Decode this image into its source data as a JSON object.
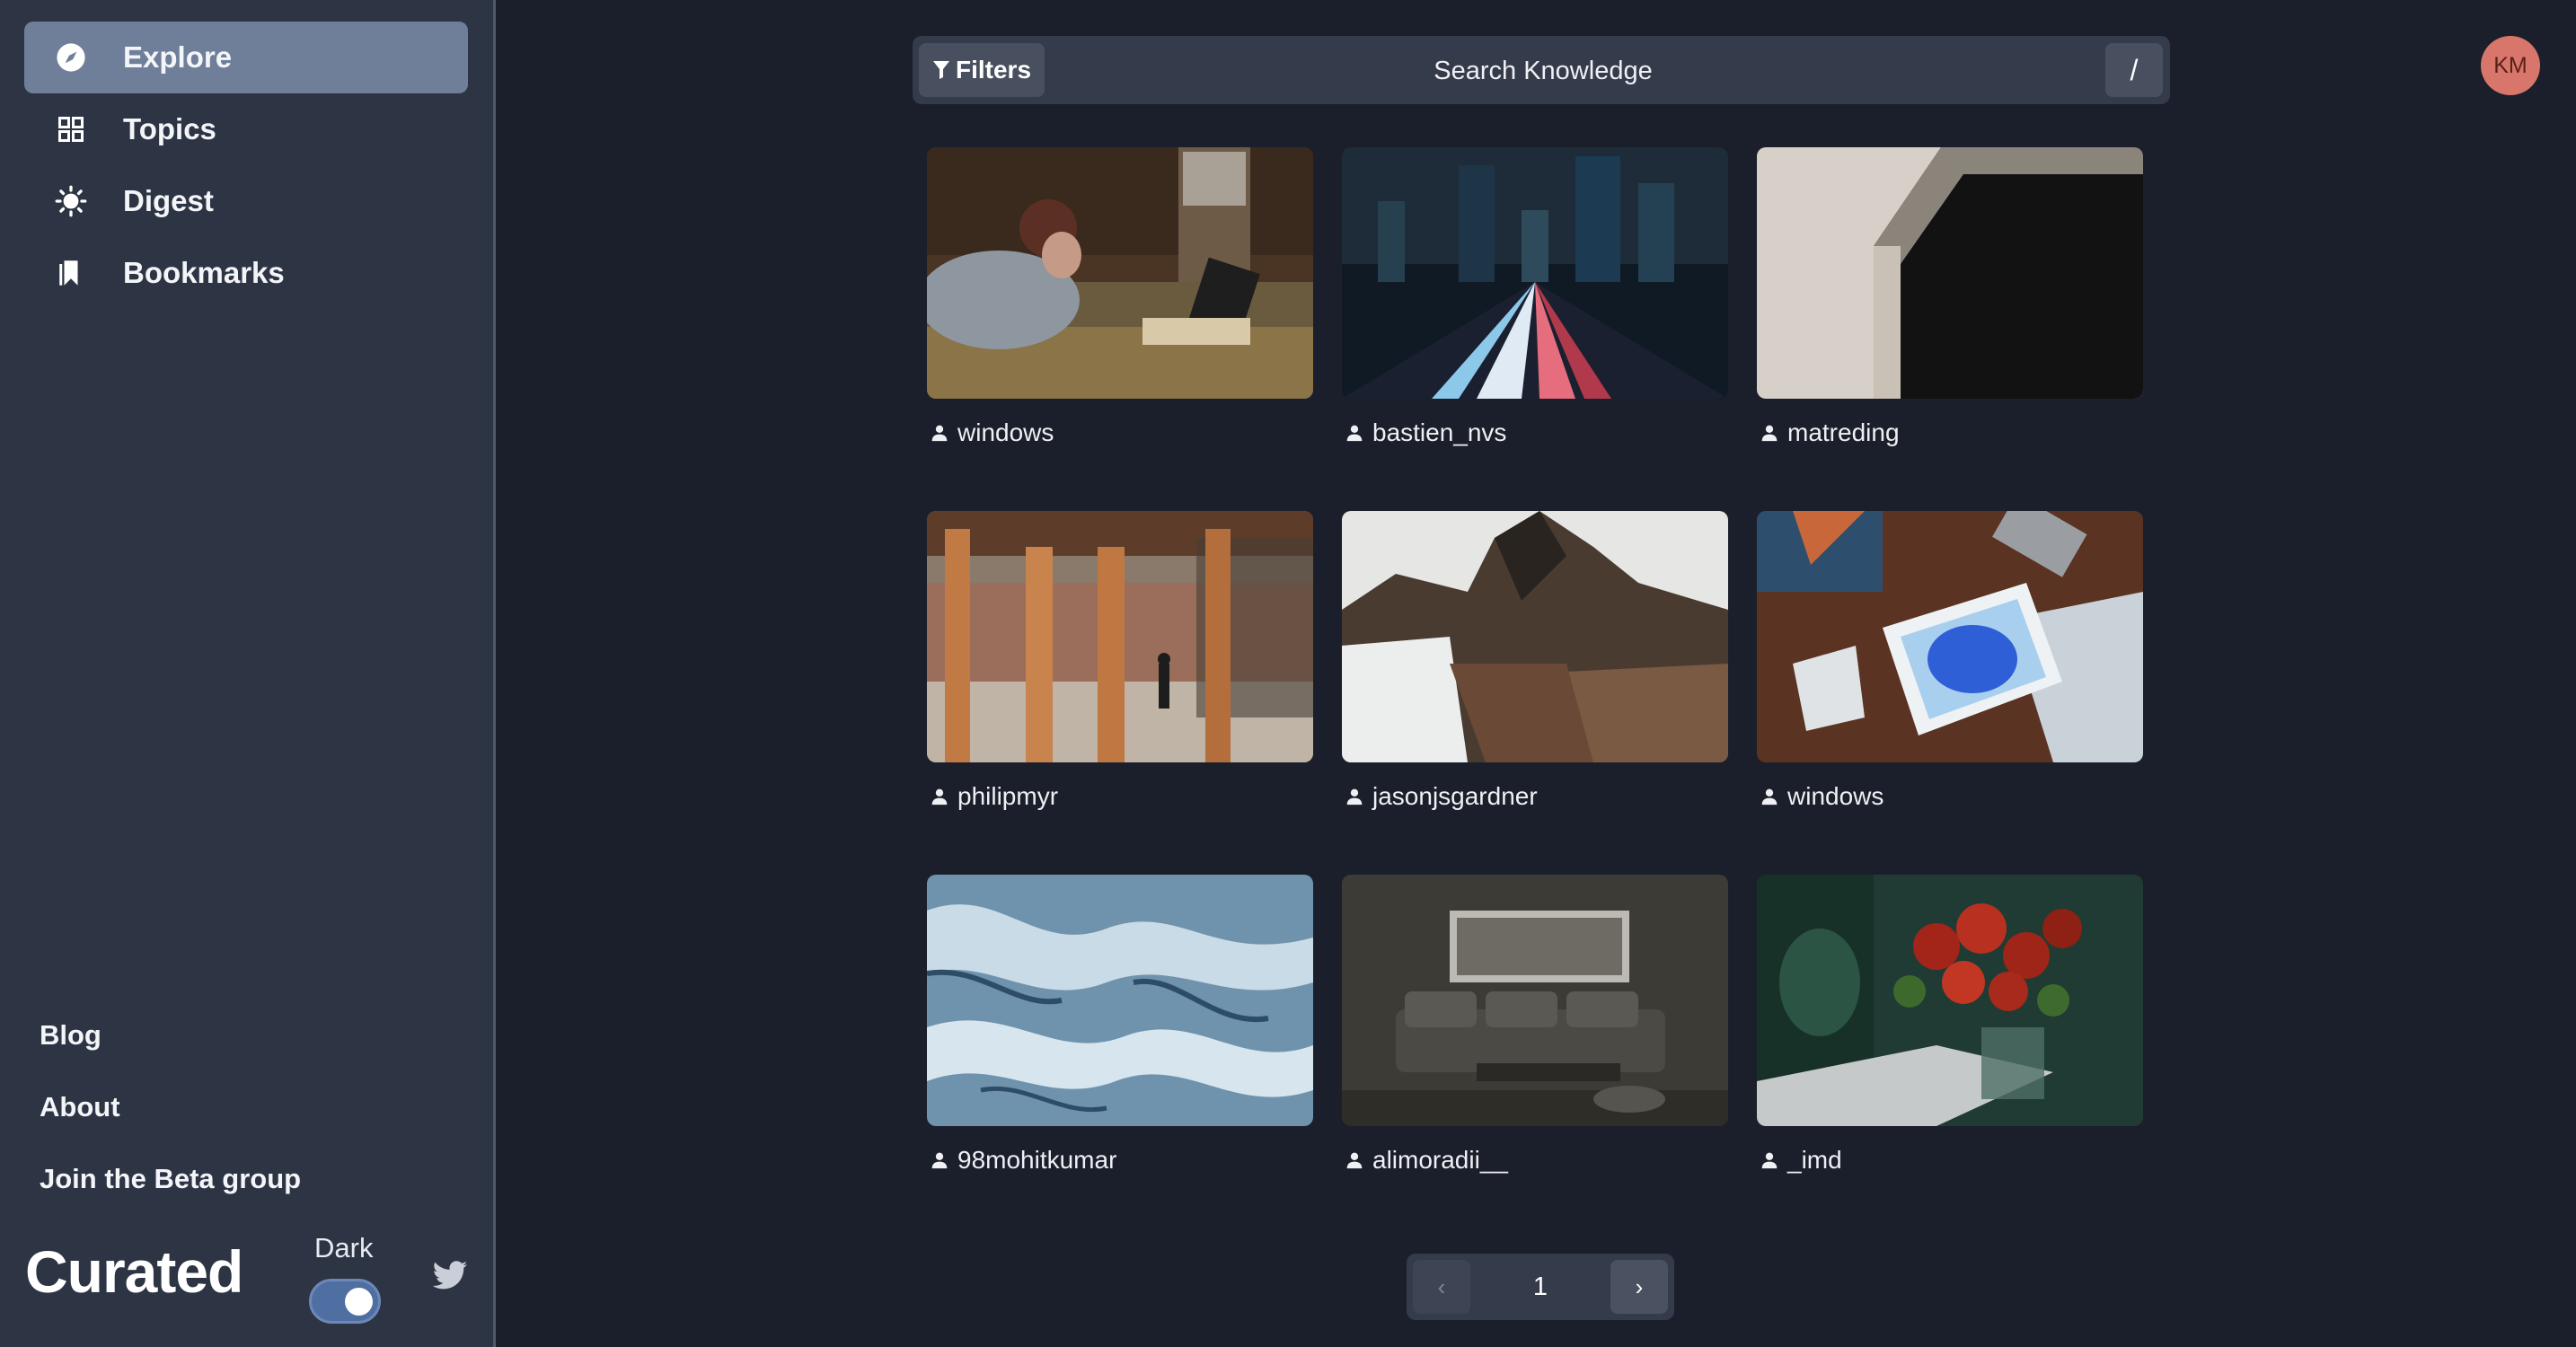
{
  "sidebar": {
    "nav": [
      {
        "label": "Explore",
        "icon": "compass-icon",
        "active": true
      },
      {
        "label": "Topics",
        "icon": "grid-icon",
        "active": false
      },
      {
        "label": "Digest",
        "icon": "sun-icon",
        "active": false
      },
      {
        "label": "Bookmarks",
        "icon": "bookmark-icon",
        "active": false
      }
    ],
    "links": [
      "Blog",
      "About",
      "Join the Beta group"
    ],
    "brand": "Curated",
    "theme_label": "Dark",
    "theme_dark": true,
    "social_icon": "twitter-icon"
  },
  "search": {
    "filters_label": "Filters",
    "placeholder": "Search Knowledge",
    "shortcut": "/"
  },
  "user": {
    "initials": "KM",
    "avatar_color": "#d9766b"
  },
  "gallery": {
    "items": [
      {
        "author": "windows",
        "image": "woman-laptop-bed"
      },
      {
        "author": "bastien_nvs",
        "image": "city-light-trails"
      },
      {
        "author": "matreding",
        "image": "architecture-corner"
      },
      {
        "author": "philipmyr",
        "image": "columns-street"
      },
      {
        "author": "jasonjsgardner",
        "image": "rocky-mountain-snow"
      },
      {
        "author": "windows",
        "image": "tablet-desk"
      },
      {
        "author": "98mohitkumar",
        "image": "aerial-ice"
      },
      {
        "author": "alimoradii__",
        "image": "living-room"
      },
      {
        "author": "_imd",
        "image": "red-flowers"
      }
    ]
  },
  "pagination": {
    "current": "1",
    "prev": "‹",
    "next": "›"
  },
  "colors": {
    "background": "#1b1f2b",
    "sidebar": "#2d3444",
    "active_nav": "#6f7f99"
  }
}
